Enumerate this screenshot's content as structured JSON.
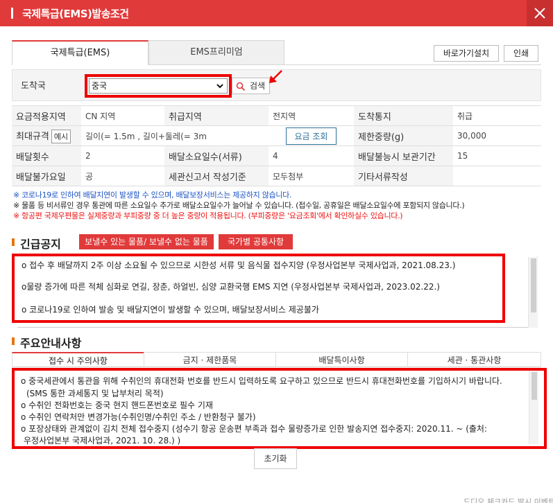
{
  "window": {
    "title": "국제특급(EMS)발송조건",
    "close_label": "×"
  },
  "tabs": [
    {
      "label": "국제특급(EMS)",
      "active": true
    },
    {
      "label": "EMS프리미엄",
      "active": false
    }
  ],
  "top_buttons": {
    "shortcut": "바로가기설치",
    "print": "인쇄"
  },
  "destination": {
    "label": "도착국",
    "selected": "중국",
    "search_label": "검색"
  },
  "info_table": {
    "row1": {
      "h1": "요금적용지역",
      "v1": "CN 지역",
      "h2": "취급지역",
      "v2": "전지역",
      "h3": "도착통지",
      "v3": "취급"
    },
    "row2": {
      "h1": "최대규격",
      "example": "예시",
      "v1": "길이(= 1.5m , 길이+둘레(= 3m",
      "fee_button": "요금 조회",
      "h3": "제한중량(g)",
      "v3": "30,000"
    },
    "row3": {
      "h1": "배달횟수",
      "v1": "2",
      "h2": "배달소요일수(서류)",
      "v2": "4",
      "h3": "배달불능시 보관기간",
      "v3": "15"
    },
    "row4": {
      "h1": "배달불가요일",
      "v1": "공",
      "h2": "세관신고서 작성기준",
      "v2": "모두첨부",
      "h3": "기타서류작성",
      "v3": ""
    }
  },
  "notes": {
    "blue": "※ 코로나19로 인하여 배달지연이 발생할 수 있으며, 배달보장서비스는 제공하지 않습니다.",
    "black": "※ 물품 등 비서류인 경우 통관에 따른 소요일수 추가로 배달소요일수가 늘어날 수 있습니다. (접수일, 공휴일은 배달소요일수에 포함되지 않습니다.)",
    "red": "※ 항공편 국제우편물은 실제중량과 부피중량 중 더 높은 중량이 적용됩니다. (부피중량은 '요금조회'에서 확인하실수 있습니다.)"
  },
  "urgent": {
    "title": "긴급공지",
    "btn_items": "보낼수 있는 물품/ 보낼수 없는 물품",
    "btn_country": "국가별 공통사항",
    "items": [
      "o 접수 후 배달까지 2주 이상 소요될 수 있으므로 시한성 서류 및 음식물 접수지양 (우정사업본부 국제사업과, 2021.08.23.)",
      "o물량 증가에 따른 적체 심화로 연길, 장춘, 하얼빈, 심양 교환국행 EMS 지연 (우정사업본부 국제사업과, 2023.02.22.)",
      "o 코로나19로 인하여 발송 및 배달지연이 발생할 수 있으며, 배달보장서비스 제공불가"
    ]
  },
  "guide": {
    "title": "주요안내사항",
    "tabs": [
      "접수 시 주의사항",
      "금지 · 제한품목",
      "배달특이사항",
      "세관 · 통관사항"
    ],
    "items": [
      "o 중국세관에서 통관을 위해 수취인의 휴대전화 번호를 반드시 입력하도록 요구하고 있으므로 반드시 휴대전화번호를 기입하시기 바랍니다.",
      "(SMS 통한 과세통지 및 납부처리 목적)",
      "o 수취인 전화번호는 중국 현지 핸드폰번호로 필수 기재",
      "o 수취인 연락처만 변경가능(수취인명/수취인 주소 / 반환청구 불가)",
      "o 포장상태와 관계없이 김치 전체 접수중지 (성수기 항공 운송편 부족과 접수 물량증가로 인한 발송지연 접수중지: 2020.11. ~ (출처:",
      "우정사업본부 국제사업과, 2021. 10. 28.) )"
    ]
  },
  "reset_label": "초기화",
  "bottom_text": "드디오 체크카드 발시 이벤트",
  "colors": {
    "accent": "#e13a3a",
    "highlight_outline": "#ee0000",
    "note_blue": "#1a53c4",
    "note_red": "#ee1111",
    "fee_button": "#2b6f9a",
    "section_marker": "#e8740f"
  }
}
